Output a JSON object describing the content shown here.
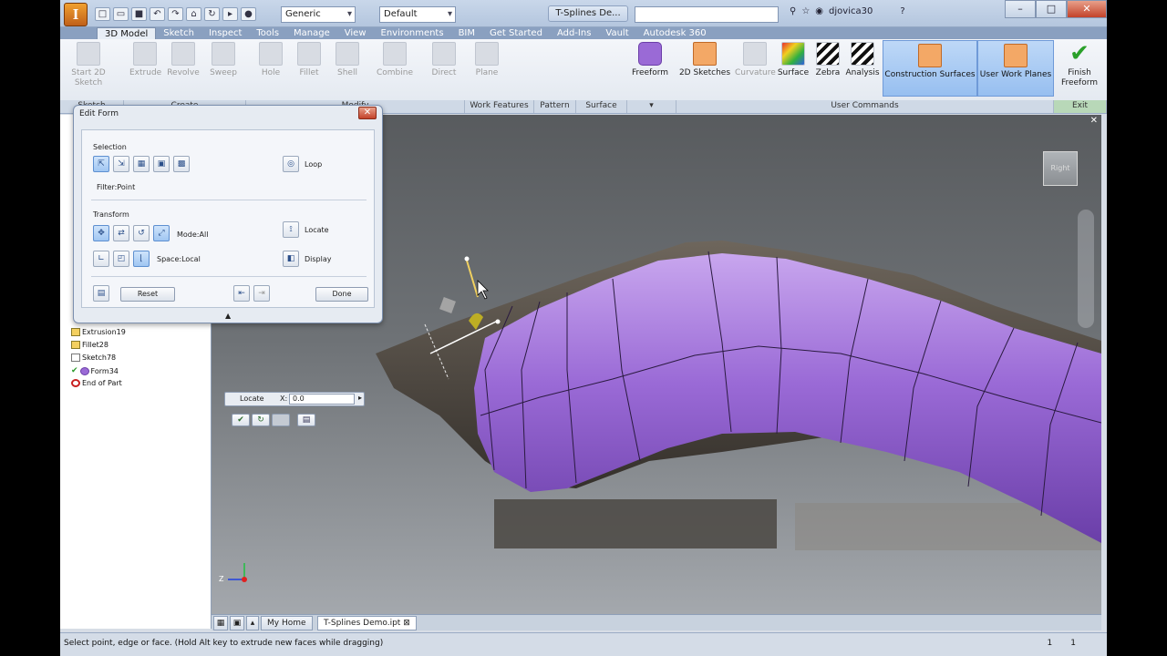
{
  "title_bar": {
    "app_letter": "I",
    "material": "Generic",
    "appearance": "Default",
    "document_title": "T-Splines De...",
    "user": "djovica30",
    "help": "?"
  },
  "ribbon_tabs": [
    "3D Model",
    "Sketch",
    "Inspect",
    "Tools",
    "Manage",
    "View",
    "Environments",
    "BIM",
    "Get Started",
    "Add-Ins",
    "Vault",
    "Autodesk 360"
  ],
  "ribbon_buttons": {
    "start_sketch": "Start 2D Sketch",
    "extrude": "Extrude",
    "revolve": "Revolve",
    "sweep": "Sweep",
    "hole": "Hole",
    "fillet": "Fillet",
    "shell": "Shell",
    "combine": "Combine",
    "direct": "Direct",
    "plane": "Plane",
    "freeform": "Freeform",
    "sketches_2d": "2D Sketches",
    "curvature": "Curvature",
    "surface": "Surface",
    "zebra": "Zebra",
    "analysis": "Analysis",
    "construction_surfaces": "Construction Surfaces",
    "user_work_planes": "User Work Planes",
    "finish_freeform": "Finish Freeform"
  },
  "panel_labels": {
    "sketch": "Sketch",
    "create": "Create",
    "modify": "Modify",
    "work_features": "Work Features",
    "pattern": "Pattern",
    "surface": "Surface",
    "user_commands": "User Commands",
    "exit": "Exit"
  },
  "browser_items": [
    "Extrusion19",
    "Fillet28",
    "Sketch78",
    "Form34",
    "End of Part"
  ],
  "dialog": {
    "title": "Edit Form",
    "selection_label": "Selection",
    "loop_label": "Loop",
    "filter_label": "Filter:Point",
    "transform_label": "Transform",
    "mode_label": "Mode:All",
    "locate_label": "Locate",
    "space_label": "Space:Local",
    "display_label": "Display",
    "reset_button": "Reset",
    "done_button": "Done"
  },
  "mini_toolbar": {
    "locate_label": "Locate",
    "x_label": "X:",
    "x_value": "0.0"
  },
  "viewcube_label": "Right",
  "axis_label": "Z",
  "doc_tabs": {
    "home": "My Home",
    "document": "T-Splines Demo.ipt"
  },
  "status": {
    "message": "Select point, edge or face. (Hold Alt key to extrude new faces while dragging)",
    "count1": "1",
    "count2": "1"
  },
  "colors": {
    "freeform_body": "#9a6ad6",
    "accent_blue": "#9fc6f2"
  }
}
